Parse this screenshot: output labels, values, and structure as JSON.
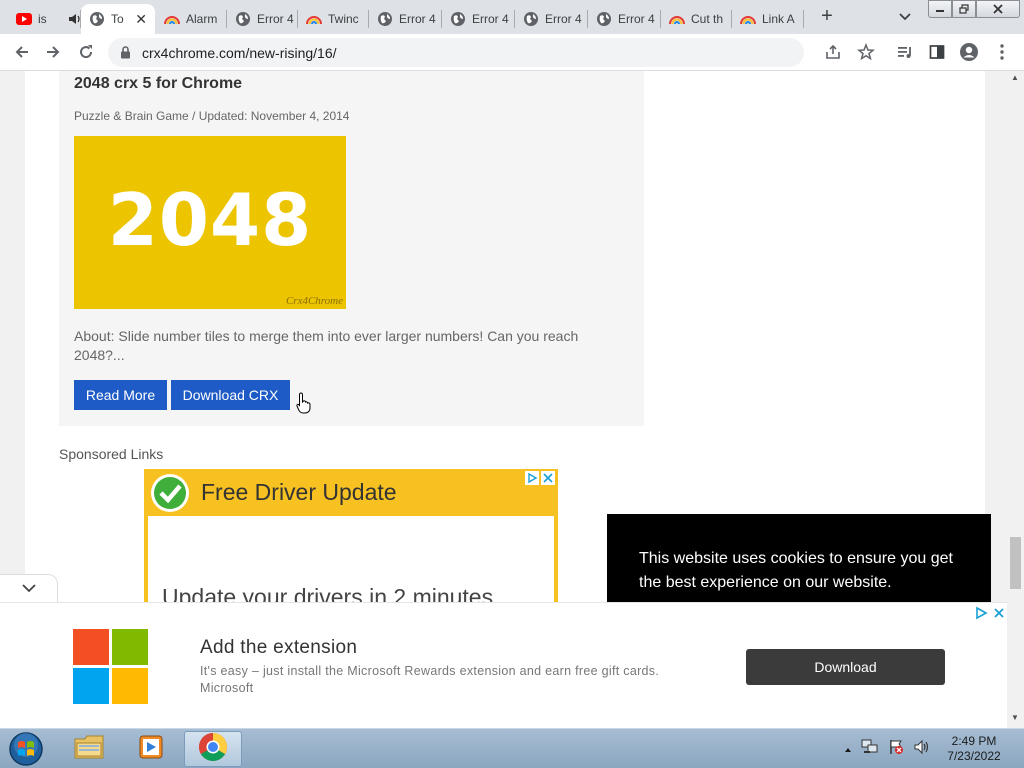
{
  "browser": {
    "tabs": [
      {
        "label": "is",
        "favicon": "youtube-icon",
        "audio": true
      },
      {
        "label": "To",
        "favicon": "globe-icon",
        "active": true,
        "close": "✕"
      },
      {
        "label": "Alarm",
        "favicon": "rainbow-icon"
      },
      {
        "label": "Error 4",
        "favicon": "globe-icon"
      },
      {
        "label": "Twinc",
        "favicon": "rainbow-icon"
      },
      {
        "label": "Error 4",
        "favicon": "globe-icon"
      },
      {
        "label": "Error 4",
        "favicon": "globe-icon"
      },
      {
        "label": "Error 4",
        "favicon": "globe-icon"
      },
      {
        "label": "Error 4",
        "favicon": "globe-icon"
      },
      {
        "label": "Cut th",
        "favicon": "rainbow-icon"
      },
      {
        "label": "Link A",
        "favicon": "rainbow-icon"
      }
    ],
    "new_tab": "+",
    "url": "crx4chrome.com/new-rising/16/"
  },
  "page": {
    "post": {
      "title": "2048 crx 5 for Chrome",
      "meta": "Puzzle & Brain Game / Updated: November 4, 2014",
      "image_text": "2048",
      "image_watermark": "Crx4Chrome",
      "about": "About: Slide number tiles to merge them into ever larger numbers! Can you reach 2048?...",
      "read_more": "Read More",
      "download_crx": "Download CRX"
    },
    "sponsored_label": "Sponsored Links",
    "ad_driver": {
      "headline": "Free Driver Update",
      "tagline": "Update your drivers in 2 minutes"
    },
    "cookie_notice": "This website uses cookies to ensure you get the best experience on our website.",
    "ad_extension": {
      "title": "Add the extension",
      "description": "It's easy – just install the Microsoft Rewards extension and earn free gift cards.",
      "brand": "Microsoft",
      "button": "Download"
    }
  },
  "taskbar": {
    "time": "2:49 PM",
    "date": "7/23/2022"
  },
  "colors": {
    "button_blue": "#1e5bc6",
    "tile_yellow": "#ecc400",
    "ad_yellow": "#f7c221",
    "cookie_bg": "#000000"
  }
}
